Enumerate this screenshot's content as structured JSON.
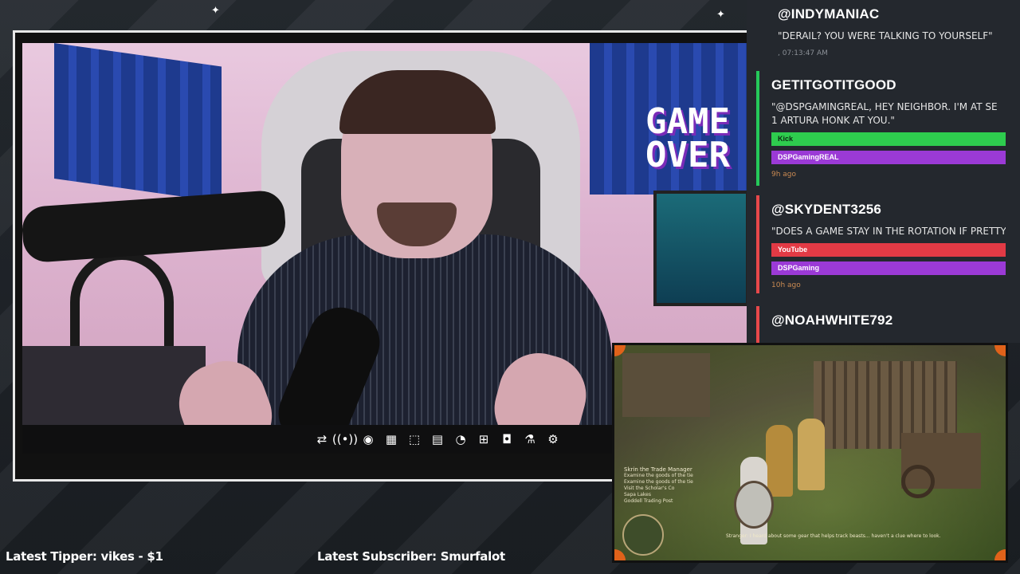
{
  "toolbar": {
    "icons": [
      "repeat-icon",
      "broadcast-icon",
      "eye-icon",
      "clapper-icon",
      "resize-icon",
      "film-icon",
      "speedometer-icon",
      "add-frame-icon",
      "camera-icon",
      "flask-icon",
      "gear-icon"
    ]
  },
  "webcam": {
    "wall_sign": "GAME\nOVER"
  },
  "chat": {
    "messages": [
      {
        "handle": "@INDYMANIAC",
        "text": "\"DERAIL? YOU WERE TALKING TO YOURSELF\"",
        "time": ", 07:13:47 AM",
        "accent": "#5fb0ff",
        "tags": []
      },
      {
        "handle": "GETITGOTITGOOD",
        "text": "\"@DSPGAMINGREAL, HEY NEIGHBOR. I'M AT SE 1 ARTURA HONK AT YOU.\"",
        "time": "9h ago",
        "accent": "#25c95a",
        "tags": [
          {
            "label": "Kick",
            "color": "#2ecc4e"
          },
          {
            "label": "DSPGamingREAL",
            "color": "#9b3ad6"
          }
        ]
      },
      {
        "handle": "@SKYDENT3256",
        "text": "\"DOES A GAME STAY IN THE ROTATION IF PRETTY",
        "time": "10h ago",
        "accent": "#e8484a",
        "tags": [
          {
            "label": "YouTube",
            "color": "#e23a45"
          },
          {
            "label": "DSPGaming",
            "color": "#9b3ad6"
          }
        ]
      },
      {
        "handle": "@NOAHWHITE792",
        "accent": "#e8484a"
      }
    ]
  },
  "game": {
    "quest_title": "Skrin the Trade Manager",
    "quest_lines": [
      "Examine the goods of the tie",
      "Examine the goods of the tie",
      "Visit the Scholar's Co",
      "Sapa Lakes",
      "Goddell Trading Post"
    ],
    "subtitle": "Stranger: I heard about some gear that helps track beasts... haven't a clue where to look."
  },
  "footer": {
    "latest_tipper": "Latest Tipper: vikes - $1",
    "latest_subscriber": "Latest Subscriber: Smurfalot"
  },
  "colors": {
    "background": "#1f2328",
    "chat_bg": "#24282e",
    "accent_orange": "#e0621a",
    "time_orange": "#c98a52"
  }
}
